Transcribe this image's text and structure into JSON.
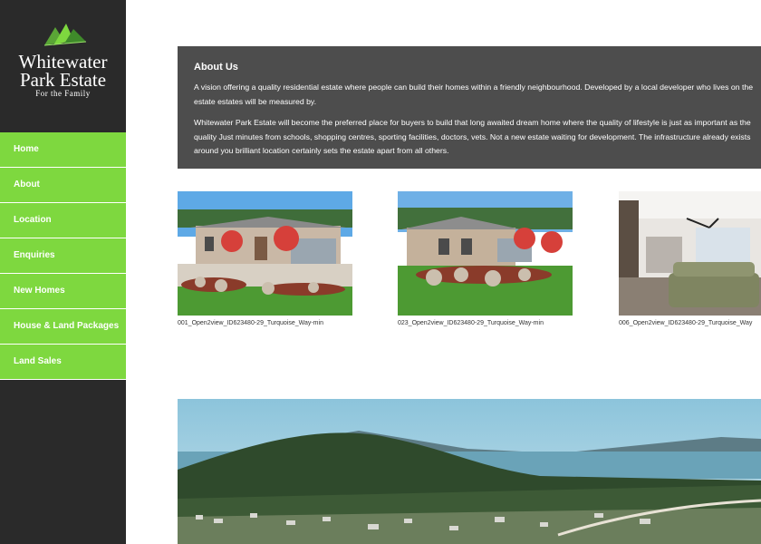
{
  "brand": {
    "name_line1": "Whitewater",
    "name_line2": "Park Estate",
    "tagline": "For the Family"
  },
  "nav": {
    "items": [
      {
        "label": "Home"
      },
      {
        "label": "About"
      },
      {
        "label": "Location"
      },
      {
        "label": "Enquiries"
      },
      {
        "label": "New Homes"
      },
      {
        "label": "House & Land Packages"
      },
      {
        "label": "Land Sales"
      }
    ]
  },
  "about": {
    "title": "About Us",
    "p1": "A vision offering a quality residential estate where people can build their homes within a friendly neighbourhood. Developed by a local developer who lives on the estate estates will be measured by.",
    "p2": "Whitewater Park Estate will become the preferred place for buyers to build that long awaited dream home where the quality of lifestyle is just as important as the quality Just minutes from schools, shopping centres, sporting facilities, doctors, vets. Not a new estate waiting for development. The infrastructure already exists around you brilliant location certainly sets the estate apart from all others."
  },
  "gallery": [
    {
      "caption": "001_Open2view_ID623480-29_Turquoise_Way-min"
    },
    {
      "caption": "023_Open2view_ID623480-29_Turquoise_Way-min"
    },
    {
      "caption": "006_Open2view_ID623480-29_Turquoise_Way"
    }
  ],
  "colors": {
    "sidebar": "#2a2a2a",
    "nav_green": "#7ed83f",
    "about_bg": "#4d4d4d"
  }
}
